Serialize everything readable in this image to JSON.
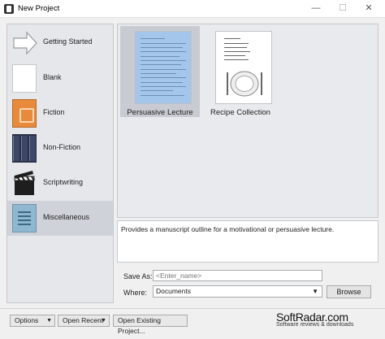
{
  "window": {
    "title": "New Project",
    "controls": {
      "minimize": "—",
      "maximize": "☐",
      "close": "✕"
    }
  },
  "sidebar": {
    "items": [
      {
        "label": "Getting Started",
        "icon": "arrow-icon"
      },
      {
        "label": "Blank",
        "icon": "blank-page-icon"
      },
      {
        "label": "Fiction",
        "icon": "fiction-book-icon"
      },
      {
        "label": "Non-Fiction",
        "icon": "nonfiction-books-icon"
      },
      {
        "label": "Scriptwriting",
        "icon": "clapperboard-icon"
      },
      {
        "label": "Miscellaneous",
        "icon": "misc-page-icon"
      }
    ],
    "selected": "Miscellaneous"
  },
  "templates": [
    {
      "label": "Persuasive Lecture",
      "selected": true
    },
    {
      "label": "Recipe Collection",
      "selected": false
    }
  ],
  "description": "Provides a manuscript outline for a motivational or persuasive lecture.",
  "form": {
    "save_as_label": "Save As:",
    "save_as_placeholder": "<Enter_name>",
    "where_label": "Where:",
    "where_value": "Documents",
    "dropdown_arrow": "▼",
    "browse_label": "Browse"
  },
  "footer": {
    "options_label": "Options",
    "open_recent_label": "Open Recent",
    "open_existing_label": "Open Existing Project...",
    "caret": "▼"
  },
  "watermark": {
    "main": "SoftRadar.com",
    "sub": "Software reviews & downloads"
  },
  "colors": {
    "selection": "#cfd2d8",
    "lecture_page": "#a4c6ea",
    "fiction": "#e88a3c"
  }
}
